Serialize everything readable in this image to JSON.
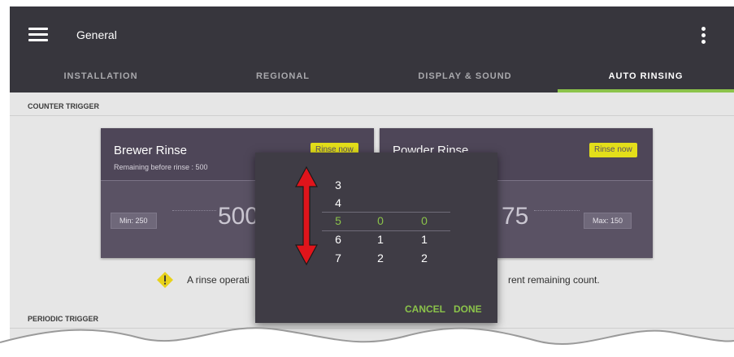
{
  "app_bar": {
    "title": "General",
    "menu_icon": "hamburger-icon",
    "more_icon": "more-vert-icon"
  },
  "tabs": [
    {
      "label": "INSTALLATION"
    },
    {
      "label": "REGIONAL"
    },
    {
      "label": "DISPLAY & SOUND"
    },
    {
      "label": "AUTO RINSING",
      "active": true
    }
  ],
  "counter_trigger": {
    "label": "COUNTER TRIGGER",
    "brewer": {
      "title": "Brewer Rinse",
      "subtitle": "Remaining before rinse : 500",
      "rinse_button": "Rinse now",
      "min_label": "Min: 250",
      "value": "500"
    },
    "powder": {
      "title": "Powder Rinse",
      "rinse_button": "Rinse now",
      "max_label": "Max: 150",
      "value": "75"
    },
    "warning": {
      "icon": "warning-icon",
      "text_left": "A rinse operati",
      "text_right": "rent remaining count."
    }
  },
  "periodic_trigger": {
    "label": "PERIODIC TRIGGER"
  },
  "picker_dialog": {
    "columns": [
      [
        "3",
        "4",
        "5",
        "6",
        "7"
      ],
      [
        "0",
        "1",
        "2"
      ],
      [
        "0",
        "1",
        "2"
      ]
    ],
    "cancel_label": "CANCEL",
    "done_label": "DONE"
  },
  "colors": {
    "app_bar": "#37363d",
    "accent": "#8bc34a",
    "card": "#5a5264",
    "rinse_button": "#e3de1a",
    "warning": "#e8d21b",
    "annotation_arrow": "#e0141b"
  }
}
